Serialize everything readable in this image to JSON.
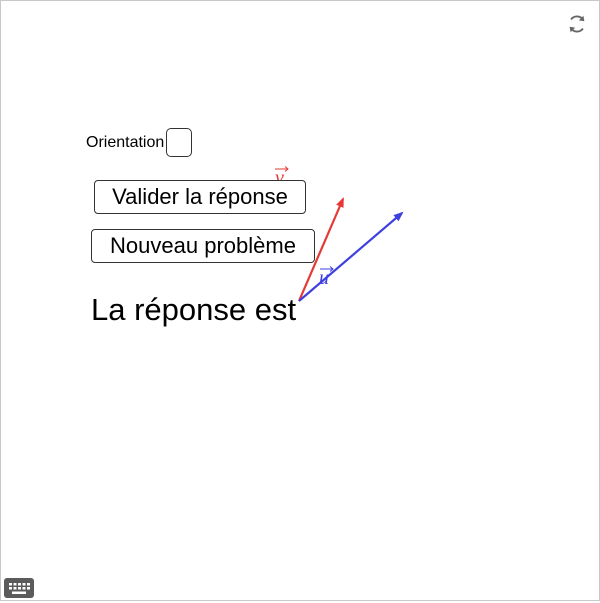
{
  "controls": {
    "orientation_label": "Orientation",
    "validate_label": "Valider la réponse",
    "new_problem_label": "Nouveau problème"
  },
  "answer": {
    "text": "La réponse est"
  },
  "vectors": [
    {
      "name": "v",
      "color": "#e53935"
    },
    {
      "name": "u",
      "color": "#3f3fe0"
    }
  ],
  "icons": {
    "reset": "reset-icon",
    "keyboard": "keyboard-icon"
  }
}
